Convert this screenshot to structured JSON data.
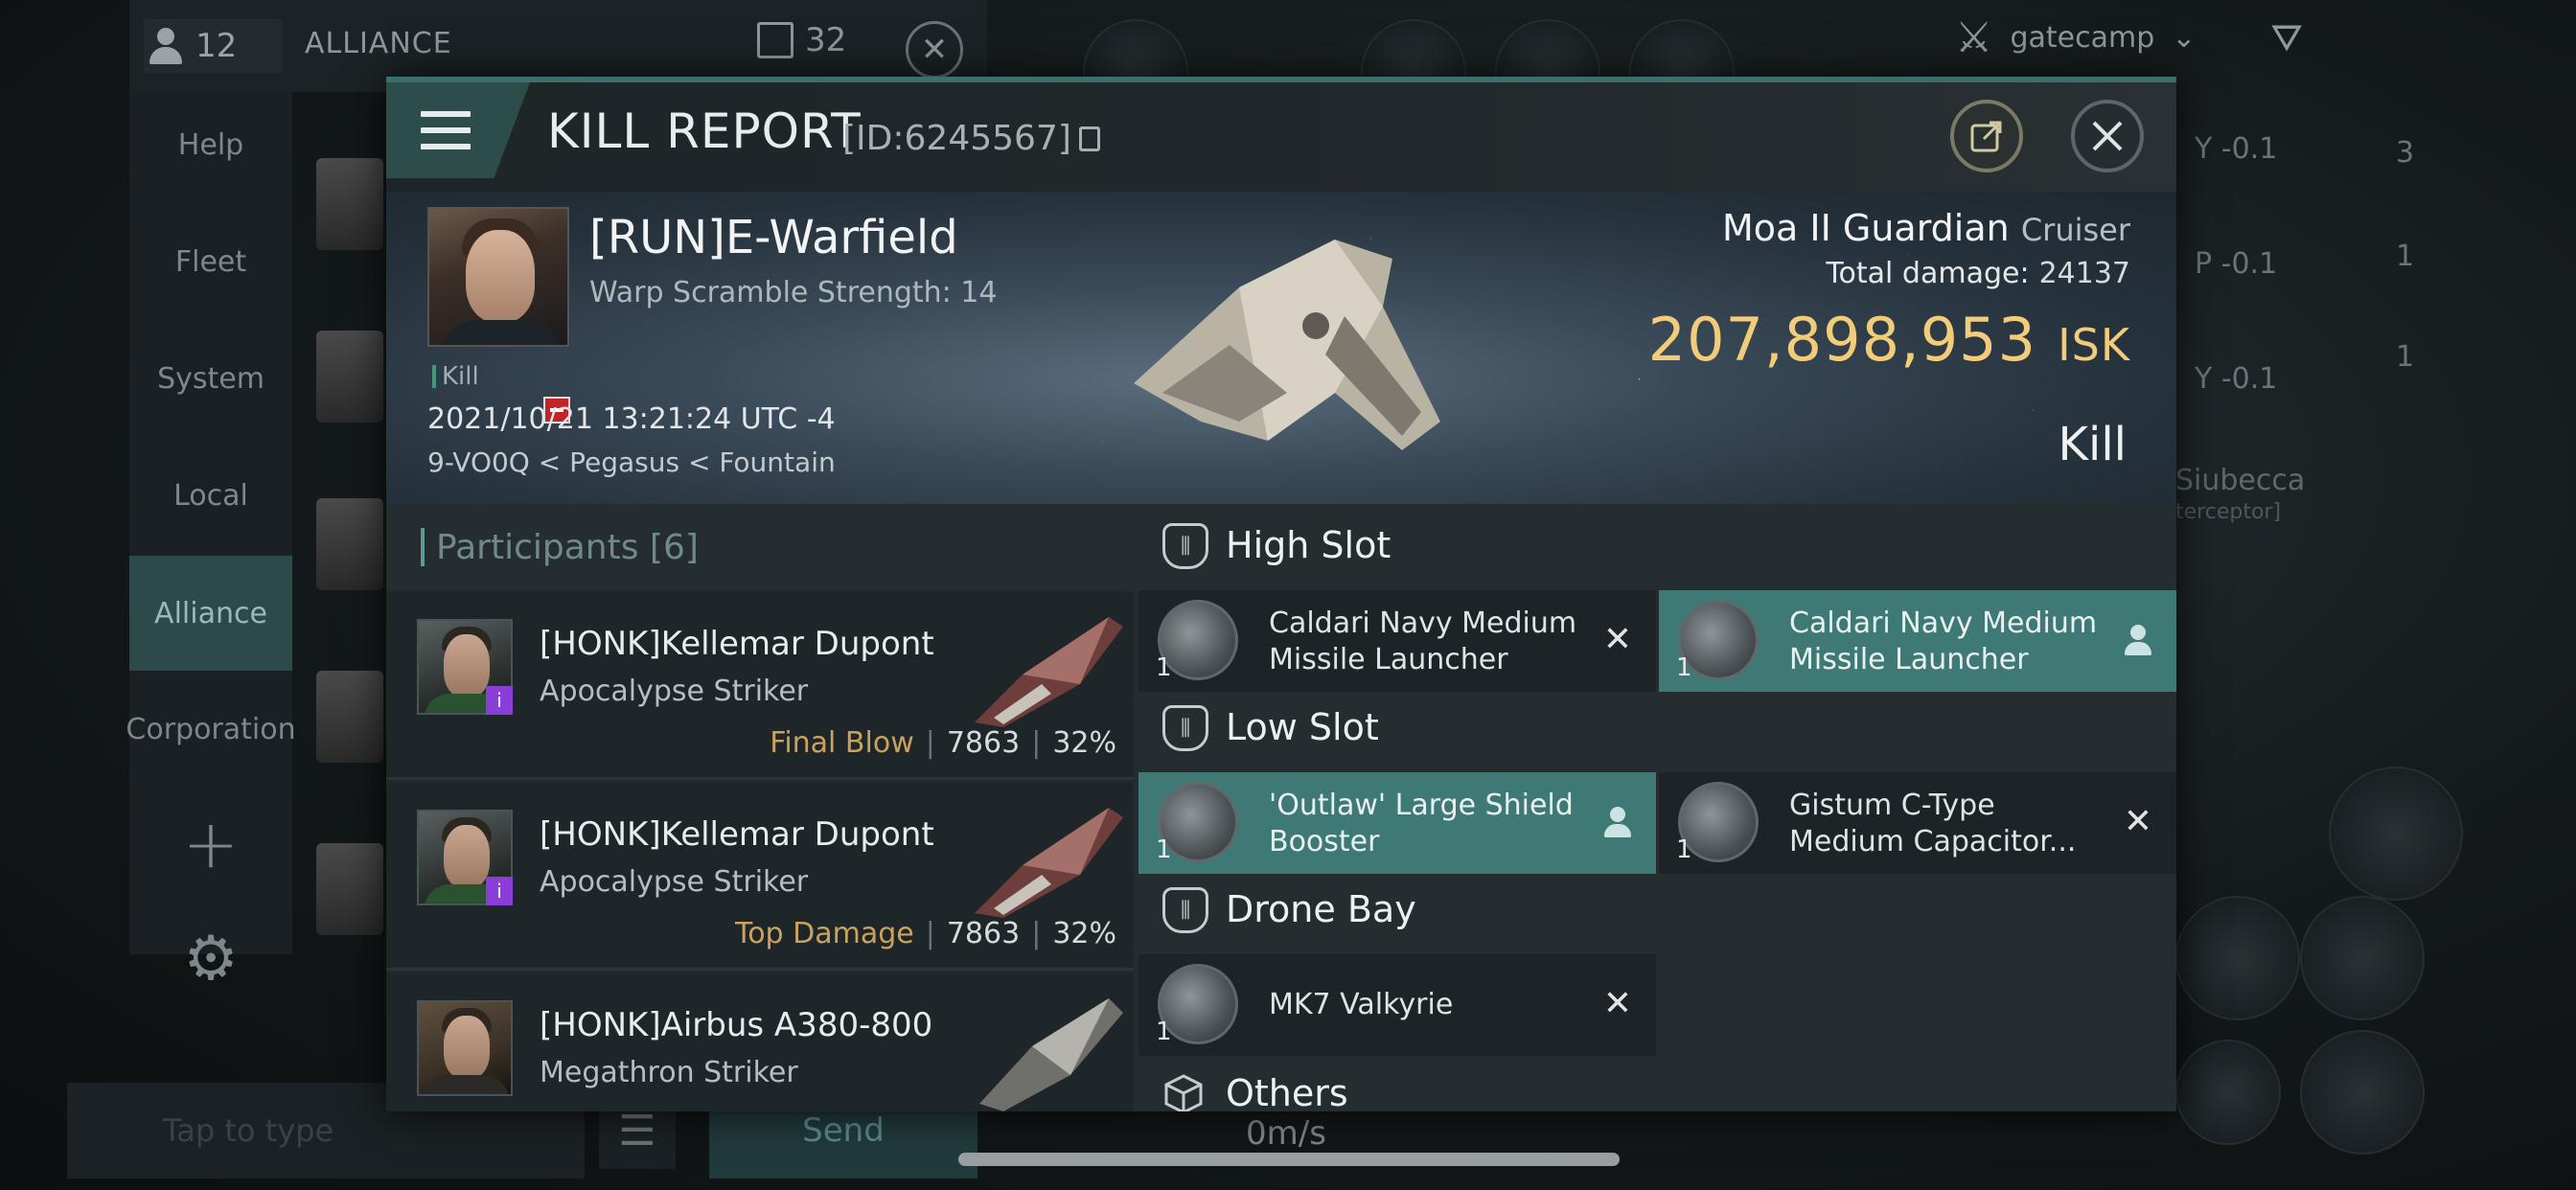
{
  "background": {
    "online_count": "12",
    "channel_name": "ALLIANCE",
    "member_count": "32",
    "sidebar": [
      "Help",
      "Fleet",
      "System",
      "Local",
      "Alliance",
      "Corporation"
    ],
    "active_sidebar": "Alliance",
    "input_placeholder": "Tap to type",
    "send_label": "Send",
    "speed": "0m/s",
    "filter_label": "gatecamp",
    "overview": [
      {
        "label": "Y -0.1",
        "count": "3"
      },
      {
        "label": "P -0.1",
        "count": "1"
      },
      {
        "label": "Y -0.1",
        "count": "1"
      }
    ],
    "overview_name": "Siubecca",
    "overview_type": "terceptor]"
  },
  "modal": {
    "title": "KILL REPORT",
    "id_label": "[ID:6245567]"
  },
  "victim": {
    "name": "[RUN]E-Warfield",
    "subtitle": "Warp Scramble Strength: 14",
    "tag": "Kill",
    "datetime": "2021/10/21 13:21:24 UTC -4",
    "location": "9-VO0Q < Pegasus < Fountain",
    "ship_name": "Moa II Guardian",
    "ship_class": "Cruiser",
    "total_damage_label": "Total damage:",
    "total_damage": "24137",
    "isk_value": "207,898,953",
    "isk_unit": "ISK",
    "result": "Kill"
  },
  "participants": {
    "label": "Participants",
    "count": "[6]",
    "rows": [
      {
        "name": "[HONK]Kellemar Dupont",
        "ship": "Apocalypse Striker",
        "tag": "Final Blow",
        "damage": "7863",
        "percent": "32%",
        "badge": "i"
      },
      {
        "name": "[HONK]Kellemar Dupont",
        "ship": "Apocalypse Striker",
        "tag": "Top Damage",
        "damage": "7863",
        "percent": "32%",
        "badge": "i"
      },
      {
        "name": "[HONK]Airbus A380-800",
        "ship": "Megathron Striker",
        "tag": "",
        "damage": "",
        "percent": "",
        "badge": ""
      }
    ]
  },
  "fittings": {
    "high_slot": "High Slot",
    "low_slot": "Low Slot",
    "drone_bay": "Drone Bay",
    "others": "Others",
    "high_modules": [
      {
        "qty": "1",
        "name": "Caldari Navy Medium Missile Launcher",
        "status": "destroyed"
      },
      {
        "qty": "1",
        "name": "Caldari Navy Medium Missile Launcher",
        "status": "dropped"
      }
    ],
    "low_modules": [
      {
        "qty": "1",
        "name": "'Outlaw' Large Shield Booster",
        "status": "dropped"
      },
      {
        "qty": "1",
        "name": "Gistum C-Type Medium Capacitor...",
        "status": "destroyed"
      }
    ],
    "drones": [
      {
        "qty": "1",
        "name": "MK7  Valkyrie",
        "status": "destroyed"
      }
    ],
    "destroyed_mark": "✕",
    "colors": {
      "dropped": "#3f7976",
      "destroyed": "#1d2326",
      "isk": "#f2cc7a",
      "accent": "#3c6e6b"
    }
  }
}
